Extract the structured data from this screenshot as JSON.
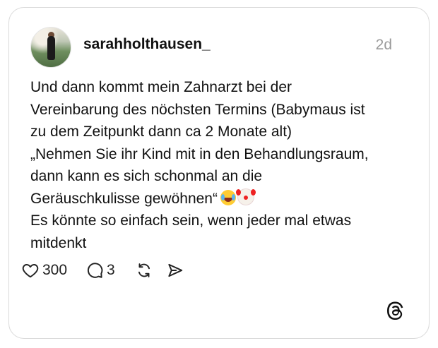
{
  "post": {
    "username": "sarahholthausen_",
    "timestamp": "2d",
    "lines": [
      "Und dann kommt mein Zahnarzt bei der",
      "Vereinbarung des nöchsten Termins (Babymaus ist",
      "zu dem Zeitpunkt dann ca 2 Monate alt)",
      "„Nehmen Sie ihr Kind mit in den Behandlungsraum,",
      "dann kann es sich schonmal an die",
      "Geräuschkulisse gewöhnen“",
      "Es könnte so einfach sein, wenn jeder mal etwas",
      "mitdenkt"
    ],
    "emojis": [
      "face-with-tears-of-joy",
      "clown-face"
    ]
  },
  "actions": {
    "likes": "300",
    "replies": "3",
    "icons": [
      "heart-icon",
      "comment-icon",
      "repost-icon",
      "share-icon"
    ]
  },
  "brand": {
    "logo": "threads-logo"
  },
  "colors": {
    "text": "#111111",
    "muted": "#9a9a9a",
    "border": "#d9d9d9"
  }
}
